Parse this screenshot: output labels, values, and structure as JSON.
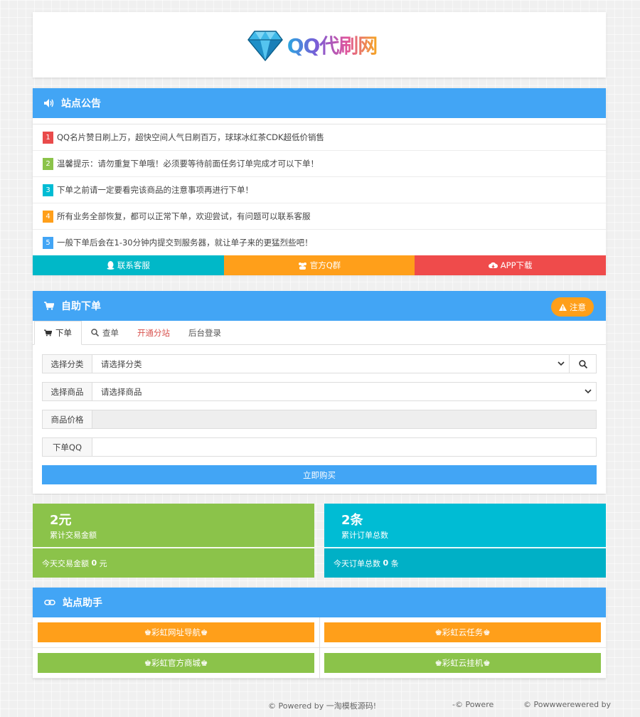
{
  "logo": {
    "text": "QQ代刷网",
    "icon": "diamond-icon"
  },
  "notice": {
    "title": "站点公告",
    "items": [
      {
        "num": "1",
        "text": "QQ名片赞日刷上万，超快空间人气日刷百万，球球冰红茶CDK超低价销售",
        "color": "#e94b4b"
      },
      {
        "num": "2",
        "text": "温馨提示：请勿重复下单哦！必须要等待前面任务订单完成才可以下单！",
        "color": "#8bc34a"
      },
      {
        "num": "3",
        "text": "下单之前请一定要看完该商品的注意事项再进行下单！",
        "color": "#00bcd4"
      },
      {
        "num": "4",
        "text": "所有业务全部恢复，都可以正常下单，欢迎尝试，有问题可以联系客服",
        "color": "#ff9f1a"
      },
      {
        "num": "5",
        "text": "一般下单后会在1-30分钟内提交到服务器，就让单子来的更猛烈些吧！",
        "color": "#42a5f5"
      }
    ],
    "buttons": [
      {
        "label": "联系客服",
        "icon": "qq-penguin-icon",
        "color": "#00b8c8"
      },
      {
        "label": "官方Q群",
        "icon": "group-icon",
        "color": "#ff9f1a"
      },
      {
        "label": "APP下载",
        "icon": "cloud-download-icon",
        "color": "#ef4b4b"
      }
    ]
  },
  "order": {
    "title": "自助下单",
    "notice_button": "注意",
    "tabs": [
      "下单",
      "查单",
      "开通分站",
      "后台登录"
    ],
    "form": {
      "category_label": "选择分类",
      "category_value": "请选择分类",
      "product_label": "选择商品",
      "product_value": "请选择商品",
      "price_label": "商品价格",
      "price_value": "",
      "qq_label": "下单QQ",
      "qq_value": ""
    },
    "buy_button": "立即购买"
  },
  "stats": {
    "amount": {
      "big": "2元",
      "sub": "累计交易金额",
      "today": "今天交易金额",
      "today_value": "0",
      "unit": "元"
    },
    "orders": {
      "big": "2条",
      "sub": "累计订单总数",
      "today": "今天订单总数",
      "today_value": "0",
      "unit": "条"
    }
  },
  "helper": {
    "title": "站点助手",
    "buttons": [
      "♚彩虹网址导航♚",
      "♚彩虹云任务♚",
      "♚彩虹官方商城♚",
      "♚彩虹云挂机♚"
    ]
  },
  "footer": {
    "left": "© Powered by 一淘模板源码!",
    "middle": "-© Powere",
    "right": "© Powwwerewered by"
  },
  "colors": {
    "primary": "#42a5f5",
    "green": "#8bc34a",
    "cyan": "#00bcd4",
    "orange": "#ff9f1a",
    "red": "#ef4b4b"
  }
}
